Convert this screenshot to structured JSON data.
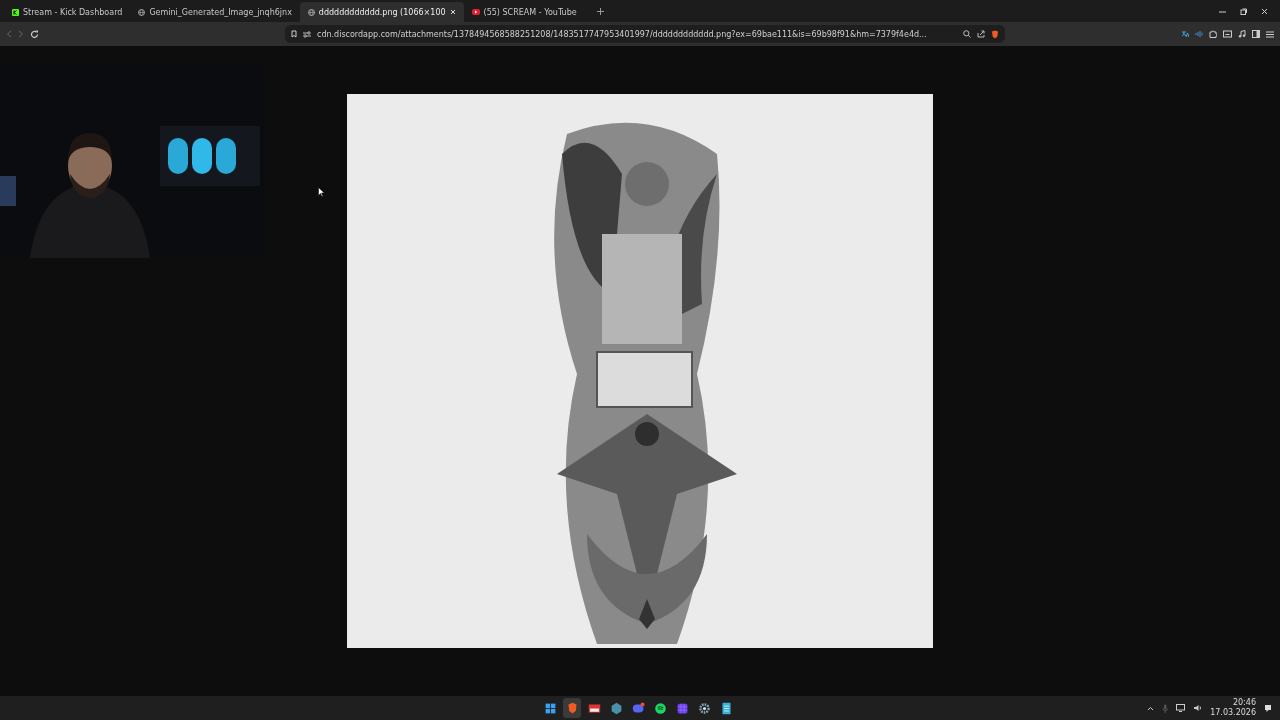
{
  "tabs": [
    {
      "title": "Stream - Kick Dashboard",
      "kind": "kick",
      "selected": false
    },
    {
      "title": "Gemini_Generated_Image_jnqh6jnx",
      "kind": "globe",
      "selected": false
    },
    {
      "title": "dddddddddddd.png (1066×100",
      "kind": "globe",
      "selected": true
    },
    {
      "title": "(55) SCREAM - YouTube",
      "kind": "youtube",
      "selected": false
    }
  ],
  "address_bar": {
    "url": "cdn.discordapp.com/attachments/1378494568588251208/1483517747953401997/dddddddddddd.png?ex=69bae111&is=69b98f91&hm=7379f4e4d..."
  },
  "taskbar": {
    "apps": [
      {
        "kind": "start",
        "selected": false
      },
      {
        "kind": "brave",
        "selected": true
      },
      {
        "kind": "news",
        "selected": false
      },
      {
        "kind": "hexagon",
        "selected": false
      },
      {
        "kind": "discord",
        "selected": false
      },
      {
        "kind": "spotify",
        "selected": false
      },
      {
        "kind": "grid",
        "selected": false
      },
      {
        "kind": "settings",
        "selected": false
      },
      {
        "kind": "notepad",
        "selected": false
      }
    ],
    "time": "20:46",
    "date": "17.03.2026"
  }
}
